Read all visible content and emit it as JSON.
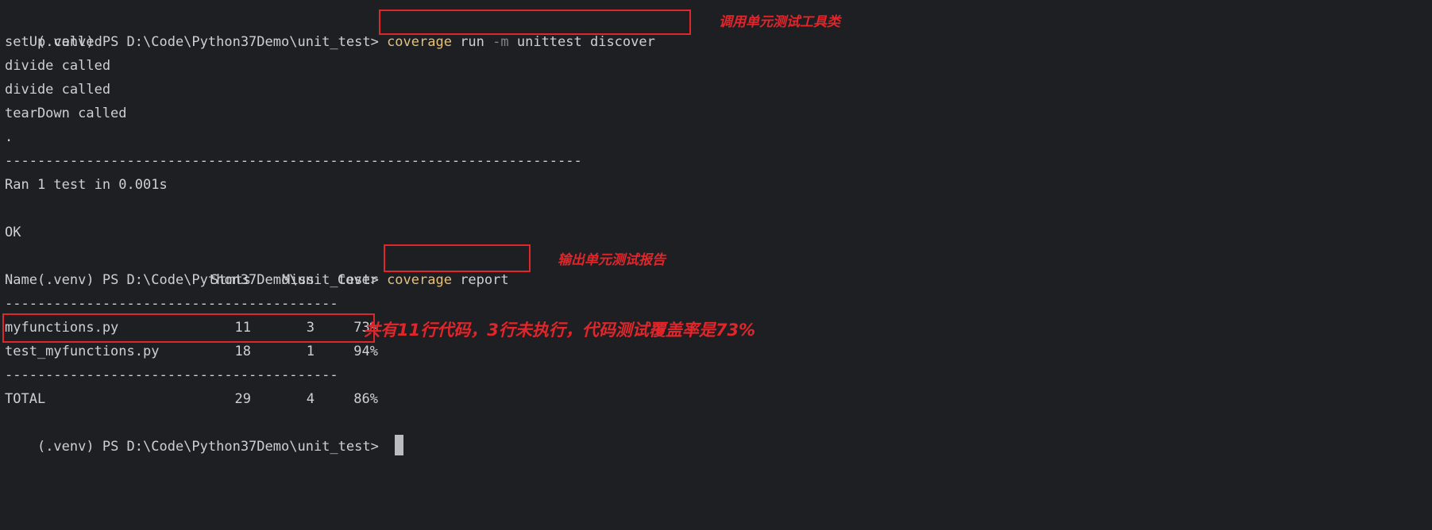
{
  "prompt": "(.venv) PS D:\\Code\\Python37Demo\\unit_test> ",
  "command1": {
    "keyword": "coverage",
    "part1": " run ",
    "flag": "-m",
    "part2": " unittest discover"
  },
  "command2": {
    "keyword": "coverage",
    "part1": " report"
  },
  "output": {
    "setup": "setUp called",
    "divide1": "divide called",
    "divide2": "divide called",
    "teardown": "tearDown called",
    "dot": ".",
    "separator_long": "-----------------------------------------------------------------------",
    "ran": "Ran 1 test in 0.001s",
    "ok": "OK"
  },
  "report": {
    "headers": [
      "Name",
      "Stmts",
      "Miss",
      "Cover"
    ],
    "separator": "-----------------------------------------",
    "rows": [
      {
        "name": "myfunctions.py",
        "stmts": "11",
        "miss": "3",
        "cover": "73%"
      },
      {
        "name": "test_myfunctions.py",
        "stmts": "18",
        "miss": "1",
        "cover": "94%"
      }
    ],
    "total": {
      "name": "TOTAL",
      "stmts": "29",
      "miss": "4",
      "cover": "86%"
    }
  },
  "annotations": {
    "a1": "调用单元测试工具类",
    "a2": "输出单元测试报告",
    "a3": "共有11行代码，3行未执行，代码测试覆盖率是73%"
  },
  "colors": {
    "background": "#1e1f22",
    "text": "#cdd0d4",
    "keyword": "#e5c07b",
    "annotation": "#e0262b"
  }
}
